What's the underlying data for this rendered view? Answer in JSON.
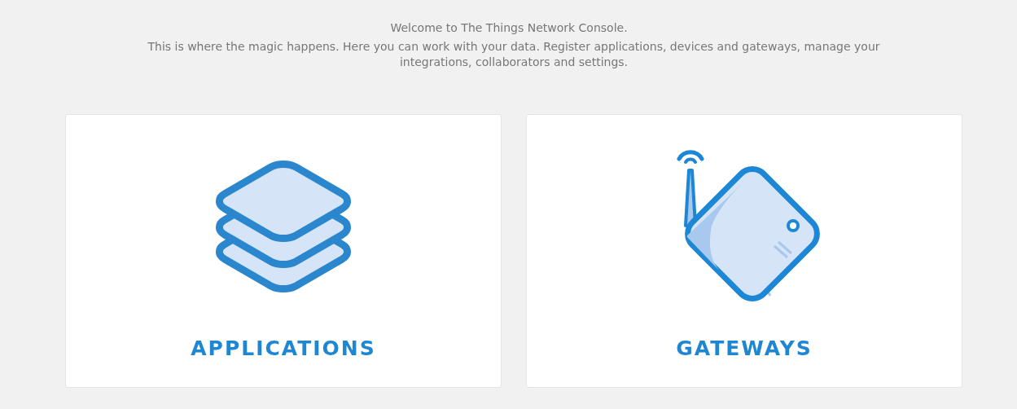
{
  "welcome": {
    "title": "Welcome to The Things Network Console.",
    "text": "This is where the magic happens. Here you can work with your data. Register applications, devices and gateways, manage your integrations, collaborators and settings."
  },
  "cards": [
    {
      "kind": "applications",
      "label": "APPLICATIONS"
    },
    {
      "kind": "gateways",
      "label": "GATEWAYS"
    }
  ]
}
